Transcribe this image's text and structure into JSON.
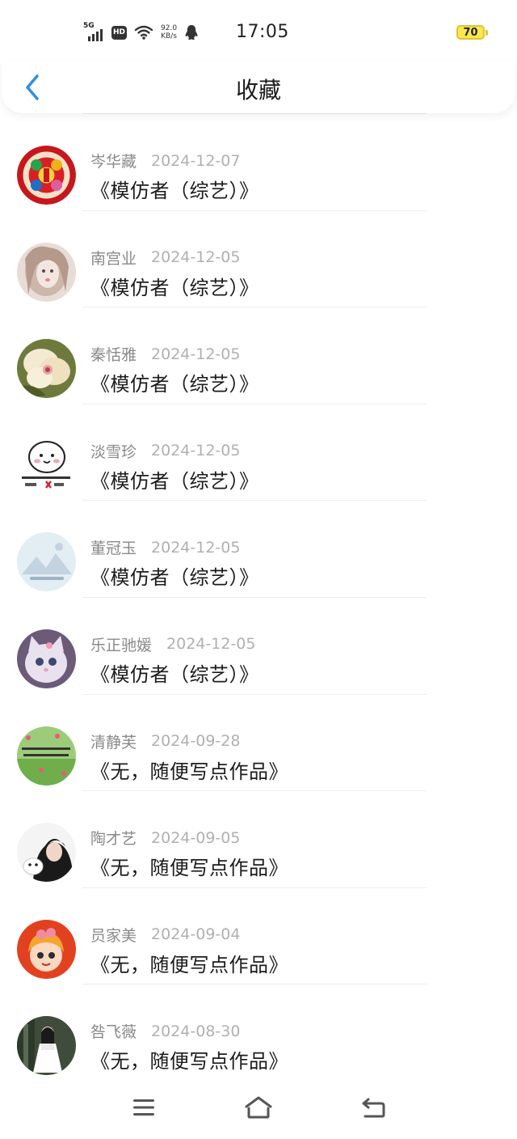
{
  "status_bar": {
    "network": "5G",
    "hd": "HD",
    "speed_value": "92.0",
    "speed_unit": "KB/s",
    "time": "17:05",
    "battery": "70"
  },
  "header": {
    "title": "收藏",
    "back_icon": "chevron-left-icon"
  },
  "colors": {
    "accent": "#2f8fe0",
    "battery": "#fbe84c"
  },
  "items": [
    {
      "name": "岑华藏",
      "date": "2024-12-07",
      "work": "《模仿者（综艺）》",
      "avatar": "avatar-paper-cut"
    },
    {
      "name": "南宫业",
      "date": "2024-12-05",
      "work": "《模仿者（综艺）》",
      "avatar": "avatar-girl"
    },
    {
      "name": "秦恬雅",
      "date": "2024-12-05",
      "work": "《模仿者（综艺）》",
      "avatar": "avatar-flower"
    },
    {
      "name": "淡雪珍",
      "date": "2024-12-05",
      "work": "《模仿者（综艺）》",
      "avatar": "avatar-cartoon"
    },
    {
      "name": "董冠玉",
      "date": "2024-12-05",
      "work": "《模仿者（综艺）》",
      "avatar": "avatar-placeholder"
    },
    {
      "name": "乐正驰媛",
      "date": "2024-12-05",
      "work": "《模仿者（综艺）》",
      "avatar": "avatar-cat"
    },
    {
      "name": "清静芙",
      "date": "2024-09-28",
      "work": "《无，随便写点作品》",
      "avatar": "avatar-green"
    },
    {
      "name": "陶才艺",
      "date": "2024-09-05",
      "work": "《无，随便写点作品》",
      "avatar": "avatar-selfie"
    },
    {
      "name": "员家美",
      "date": "2024-09-04",
      "work": "《无，随便写点作品》",
      "avatar": "avatar-red-cartoon"
    },
    {
      "name": "咎飞薇",
      "date": "2024-08-30",
      "work": "《无，随便写点作品》",
      "avatar": "avatar-photo"
    }
  ],
  "navbar": {
    "menu_icon": "menu-icon",
    "home_icon": "home-icon",
    "back_icon": "return-icon"
  }
}
